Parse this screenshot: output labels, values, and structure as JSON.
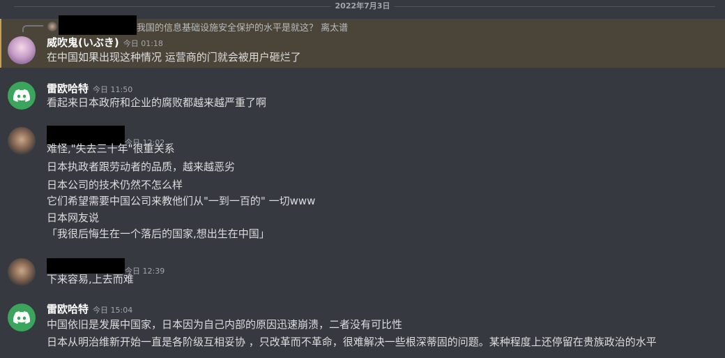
{
  "date_divider": "2022年7月3日",
  "messages": [
    {
      "reply_preview": "我国的信息基础设施安全保护的水平是就这？ 离太谱",
      "username": "威吹鬼(いぶき)",
      "timestamp": "今日 01:18",
      "lines": [
        "在中国如果出现这种情况 运营商的门就会被用户砸烂了"
      ]
    },
    {
      "username": "雷欧哈特",
      "timestamp": "今日 11:50",
      "lines": [
        "看起来日本政府和企业的腐败都越来越严重了啊"
      ]
    },
    {
      "username": "",
      "timestamp": "今日 12:02",
      "lines": [
        "难怪,\"失去三十年\"很重关系",
        "日本执政者跟劳动者的品质，越来越恶劣",
        "日本公司的技术仍然不怎么样",
        "它们希望需要中国公司来教他们从\"一到一百的\" 一切www",
        "日本网友说",
        "「我很后悔生在一个落后的国家,想出生在中国」"
      ]
    },
    {
      "username": "",
      "timestamp": "今日 12:39",
      "lines": [
        "下来容易,上去而难"
      ]
    },
    {
      "username": "雷欧哈特",
      "timestamp": "今日 15:04",
      "lines": [
        "中国依旧是发展中国家，日本因为自己内部的原因迅速崩溃，二者没有可比性",
        "日本从明治维新开始一直是各阶级互相妥协 ，只改革而不革命，很难解决一些根深蒂固的问题。某种程度上还停留在贵族政治的水平"
      ]
    }
  ]
}
